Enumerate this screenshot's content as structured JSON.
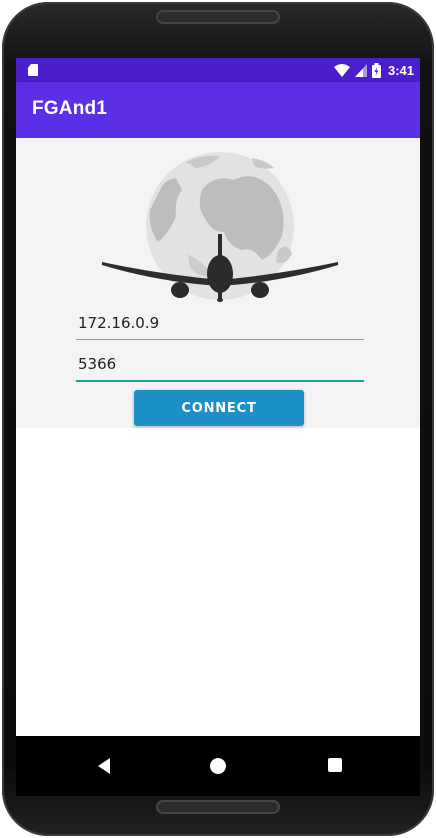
{
  "status_bar": {
    "time": "3:41",
    "icons": [
      "sd-card-icon",
      "wifi-icon",
      "signal-icon",
      "battery-icon"
    ]
  },
  "app_bar": {
    "title": "FGAnd1"
  },
  "logo": {
    "icon": "globe-airplane-logo-icon"
  },
  "form": {
    "ip_value": "172.16.0.9",
    "port_value": "5366",
    "connect_label": "CONNECT"
  },
  "nav_bar": {
    "icons": [
      "back-icon",
      "home-icon",
      "recent-apps-icon"
    ]
  },
  "colors": {
    "status_bar": "#4a1ec8",
    "app_bar": "#5c2ee6",
    "button": "#1e90c8",
    "focus_underline": "#15a89a"
  }
}
